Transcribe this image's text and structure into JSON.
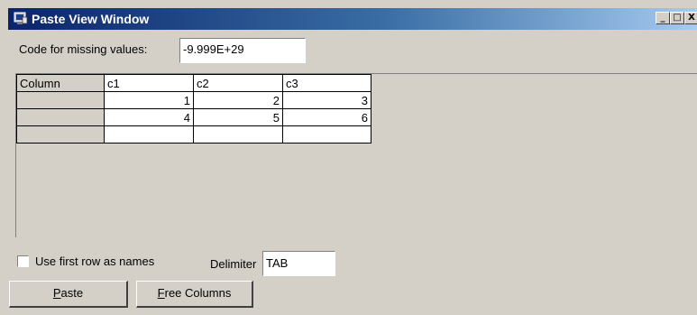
{
  "window": {
    "title": "Paste View Window",
    "icon": "window-app-icon",
    "controls": {
      "minimize": "_",
      "maximize": "□",
      "close": "X"
    }
  },
  "missing": {
    "label": "Code for missing values:",
    "value": "-9.999E+29"
  },
  "grid": {
    "headers": [
      "Column",
      "c1",
      "c2",
      "c3"
    ],
    "rows": [
      [
        "",
        "1",
        "2",
        "3"
      ],
      [
        "",
        "4",
        "5",
        "6"
      ],
      [
        "",
        "",
        "",
        ""
      ]
    ]
  },
  "options": {
    "use_first_row_label": "Use first row as names",
    "use_first_row_checked": false,
    "delimiter_label": "Delimiter",
    "delimiter_value": "TAB"
  },
  "buttons": {
    "paste_mnemonic": "P",
    "paste_rest": "aste",
    "free_mnemonic": "F",
    "free_rest": "ree Columns"
  },
  "colors": {
    "title_start": "#0a246a",
    "title_end": "#a6caf0",
    "face": "#d4d0c8"
  }
}
